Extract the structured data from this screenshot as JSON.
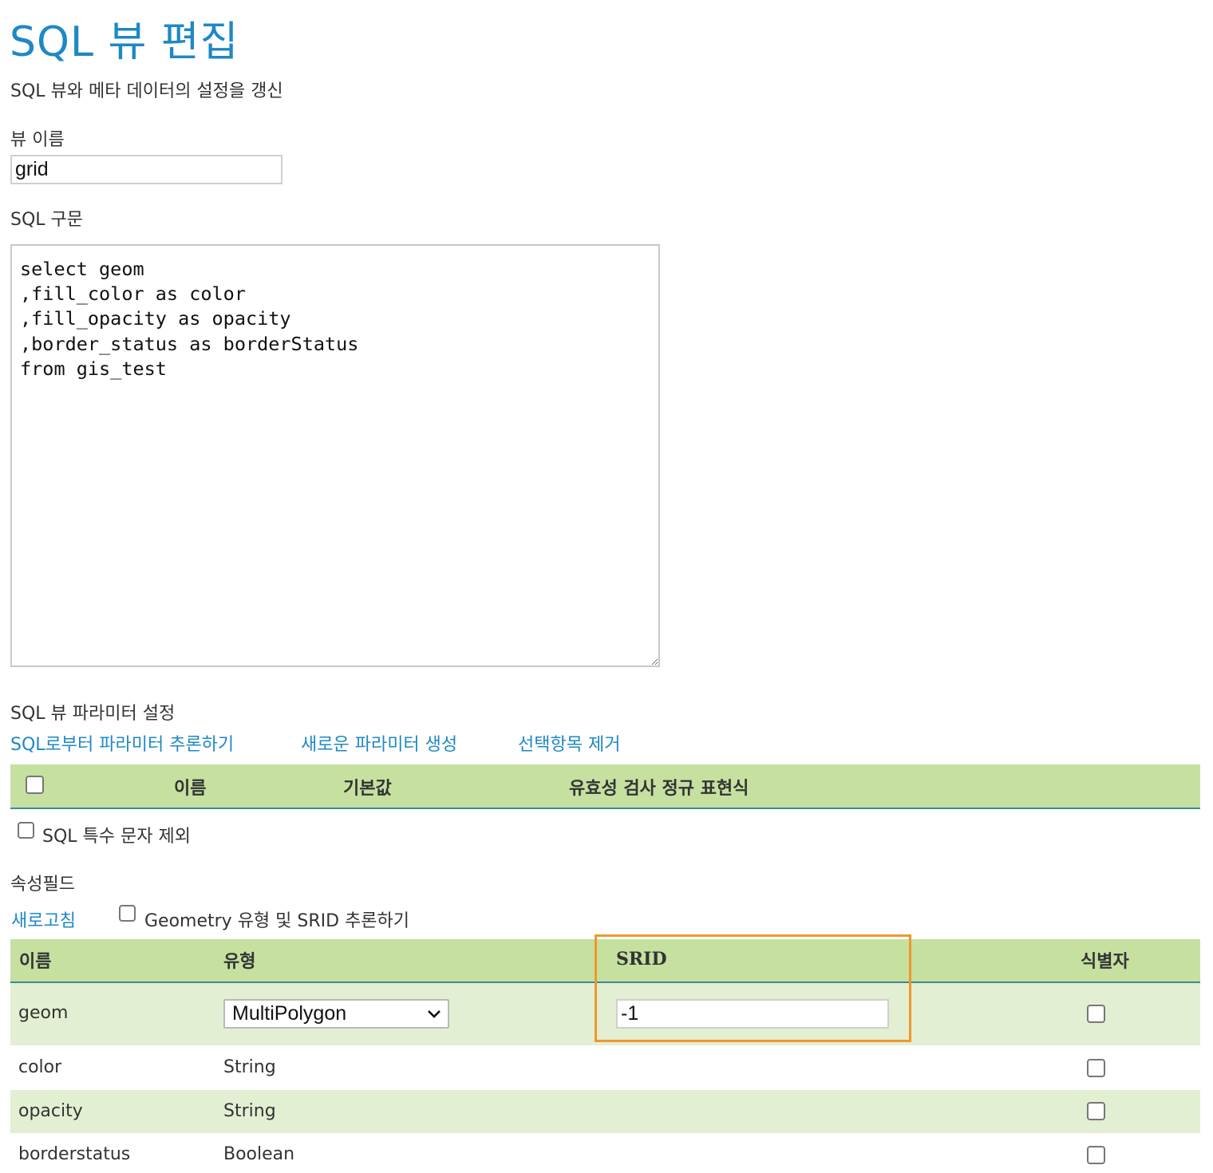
{
  "page": {
    "title": "SQL 뷰 편집",
    "subtitle": "SQL 뷰와 메타 데이터의 설정을 갱신"
  },
  "view_name": {
    "label": "뷰 이름",
    "value": "grid"
  },
  "sql": {
    "label": "SQL 구문",
    "value": "select geom\n,fill_color as color\n,fill_opacity as opacity\n,border_status as borderStatus\nfrom gis_test"
  },
  "parameters": {
    "section_label": "SQL 뷰 파라미터 설정",
    "links": {
      "guess": "SQL로부터 파라미터 추론하기",
      "new": "새로운 파라미터 생성",
      "remove": "선택항목 제거"
    },
    "columns": {
      "name": "이름",
      "default": "기본값",
      "regex": "유효성 검사 정규 표현식"
    },
    "escape_label": "SQL 특수 문자 제외"
  },
  "attributes": {
    "section_label": "속성필드",
    "refresh_link": "새로고침",
    "guess_geometry_label": "Geometry 유형 및 SRID 추론하기",
    "columns": {
      "name": "이름",
      "type": "유형",
      "srid": "SRID",
      "identifier": "식별자"
    },
    "rows": [
      {
        "name": "geom",
        "type": "MultiPolygon",
        "srid": "-1",
        "identifier": false
      },
      {
        "name": "color",
        "type": "String",
        "srid": "",
        "identifier": false
      },
      {
        "name": "opacity",
        "type": "String",
        "srid": "",
        "identifier": false
      },
      {
        "name": "borderstatus",
        "type": "Boolean",
        "srid": "",
        "identifier": false
      }
    ]
  },
  "colors": {
    "accent": "#1e88c4",
    "header_bg": "#c6e0a0",
    "alt_row_bg": "#e3efd3",
    "header_rule": "#3e8a8e",
    "highlight": "#f0962e"
  }
}
